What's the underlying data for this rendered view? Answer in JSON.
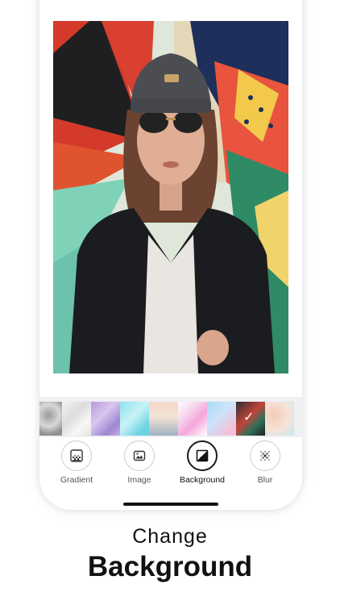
{
  "tools": [
    {
      "label": "Gradient",
      "icon": "gradient-icon",
      "active": false
    },
    {
      "label": "Image",
      "icon": "image-icon",
      "active": false
    },
    {
      "label": "Background",
      "icon": "background-icon",
      "active": true
    },
    {
      "label": "Blur",
      "icon": "blur-icon",
      "active": false
    }
  ],
  "swatches": [
    {
      "name": "grey-marble",
      "bg": "radial-gradient(circle at 40% 40%, #9a9a9a, #d8d8d8 45%, #8f8f8f 80%)"
    },
    {
      "name": "white-marble",
      "bg": "linear-gradient(135deg, #f4f4f4, #dcdcdc 40%, #f7f7f7 70%, #e3e3e3)"
    },
    {
      "name": "purple-watercolor",
      "bg": "linear-gradient(135deg, #b79bd9, #d9c6f0 40%, #9f86cf 75%, #c3aee5)"
    },
    {
      "name": "aqua-watercolor",
      "bg": "linear-gradient(135deg, #8fe0ea, #c8f3f7 45%, #6fd3e3 80%)"
    },
    {
      "name": "sunset-fade",
      "bg": "linear-gradient(180deg, #f6d8c7, #f1e2d6 45%, #9fb2c2 100%)"
    },
    {
      "name": "pink-ink",
      "bg": "linear-gradient(135deg, #ffffff, #f7d2ec 35%, #f4a6da 60%, #ffffff)"
    },
    {
      "name": "pastel-blue",
      "bg": "linear-gradient(135deg, #a9d9f5, #c9e4fb 40%, #f5bfd9 85%)"
    },
    {
      "name": "current-photo",
      "bg": "linear-gradient(135deg, #2b2d31, #c0453a 45%, #2f6f5a 70%, #1f1f1f)",
      "selected": true
    },
    {
      "name": "peach-speckle",
      "bg": "radial-gradient(circle at 30% 40%, #f3cbb8, #f6e4da 55%, #cfe7ea 90%)"
    }
  ],
  "caption": {
    "line1": "Change",
    "line2": "Background"
  },
  "colors": {
    "accent": "#111111",
    "strip_bg": "#eef0f4"
  }
}
